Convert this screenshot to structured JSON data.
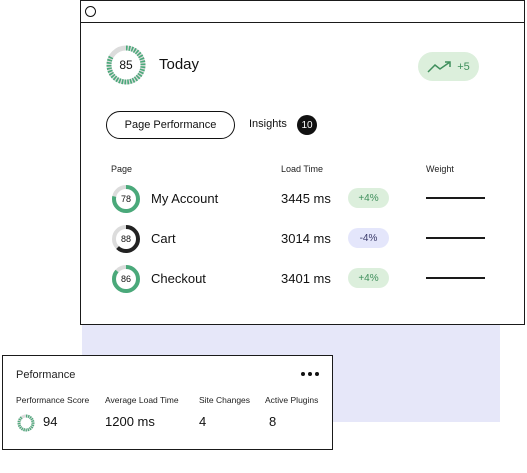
{
  "summary": {
    "score": "85",
    "score_fraction": 0.85,
    "label": "Today",
    "trend_value": "+5",
    "trend_icon": "trend-up-icon"
  },
  "tabs": {
    "active": "Page Performance",
    "insights": "Insights",
    "insights_count": "10"
  },
  "table": {
    "headers": {
      "page": "Page",
      "load_time": "Load Time",
      "weight": "Weight"
    },
    "rows": [
      {
        "score": "78",
        "score_fraction": 0.78,
        "ring_color": "#4aa97a",
        "page": "My Account",
        "load_time": "3445 ms",
        "delta": "+4%",
        "delta_type": "pos"
      },
      {
        "score": "88",
        "score_fraction": 0.62,
        "ring_color": "#222222",
        "page": "Cart",
        "load_time": "3014 ms",
        "delta": "-4%",
        "delta_type": "neg"
      },
      {
        "score": "86",
        "score_fraction": 0.86,
        "ring_color": "#4aa97a",
        "page": "Checkout",
        "load_time": "3401 ms",
        "delta": "+4%",
        "delta_type": "pos"
      }
    ]
  },
  "performance_card": {
    "title": "Peformance",
    "menu_icon": "more-horizontal-icon",
    "stats": {
      "score_label": "Performance Score",
      "score_value": "94",
      "score_fraction": 0.94,
      "avg_label": "Average Load Time",
      "avg_value": "1200 ms",
      "changes_label": "Site Changes",
      "changes_value": "4",
      "plugins_label": "Active Plugins",
      "plugins_value": "8"
    }
  },
  "colors": {
    "accent_green": "#4aa97a",
    "green_pill": "#dcefdc",
    "lavender": "#e6e7f9",
    "ring_track": "#dcdcdc"
  }
}
